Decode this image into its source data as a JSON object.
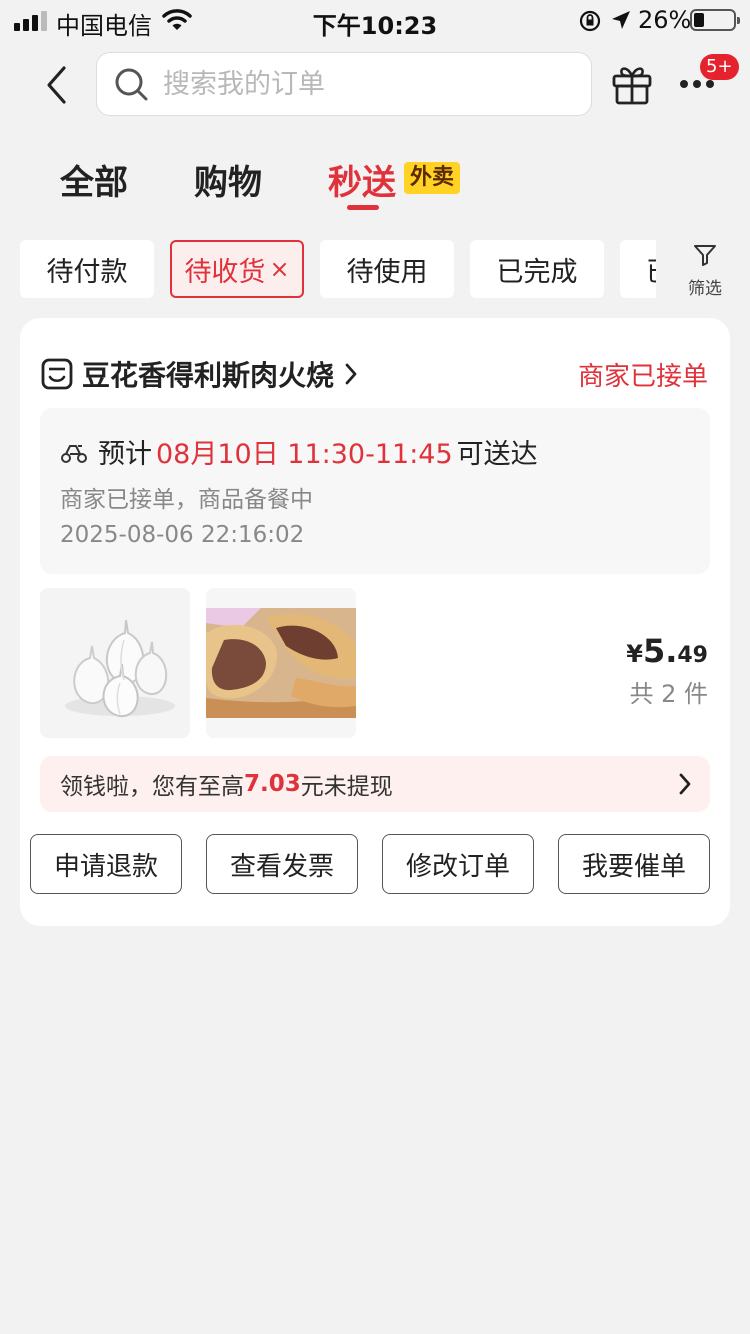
{
  "status_bar": {
    "carrier": "中国电信",
    "time": "下午10:23",
    "battery": "26%",
    "battery_level": 0.26,
    "icons": [
      "signal-icon",
      "wifi-icon",
      "orientation-lock-icon",
      "location-icon",
      "battery-icon"
    ]
  },
  "header": {
    "search_placeholder": "搜索我的订单",
    "badge": "5+",
    "icons": [
      "back-icon",
      "search-icon",
      "gift-icon",
      "more-icon"
    ]
  },
  "tabs": [
    {
      "label": "全部",
      "active": false
    },
    {
      "label": "购物",
      "active": false
    },
    {
      "label": "秒送",
      "active": true,
      "tag": "外卖"
    }
  ],
  "chips": [
    {
      "label": "待付款",
      "active": false
    },
    {
      "label": "待收货",
      "active": true,
      "close": "×"
    },
    {
      "label": "待使用",
      "active": false
    },
    {
      "label": "已完成",
      "active": false
    },
    {
      "label": "已",
      "active": false
    }
  ],
  "filter": {
    "label": "筛选",
    "icon": "filter-icon"
  },
  "order": {
    "shop_name": "豆花香得利斯肉火烧",
    "status": "商家已接单",
    "eta_prefix": "预计",
    "eta_date": "08月10日 11:30-11:45",
    "eta_suffix": "可送达",
    "delivery_status": "商家已接单，商品备餐中",
    "timestamp": "2025-08-06 22:16:02",
    "items": [
      {
        "name": "garlic",
        "image": "garlic-photo"
      },
      {
        "name": "meat-pastry",
        "image": "meat-pastry-photo"
      }
    ],
    "price_currency": "¥",
    "price_int": "5.",
    "price_dec": "49",
    "quantity": "共 2 件",
    "promo_pre": "领钱啦，您有至高",
    "promo_amount": "7.03",
    "promo_post": "元未提现",
    "actions": [
      "申请退款",
      "查看发票",
      "修改订单",
      "我要催单"
    ]
  },
  "colors": {
    "accent": "#e0323a",
    "tag": "#ffd224",
    "background": "#f2f2f2"
  }
}
